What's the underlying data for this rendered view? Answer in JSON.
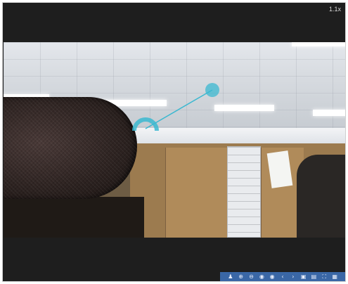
{
  "player": {
    "zoom_label": "1.1x"
  },
  "overlay": {
    "accent_color": "#3bb8d0"
  },
  "toolbar": {
    "buttons": [
      {
        "icon": "person-icon",
        "glyph": "♟"
      },
      {
        "icon": "zoom-in-icon",
        "glyph": "⊕"
      },
      {
        "icon": "zoom-out-icon",
        "glyph": "⊖"
      },
      {
        "icon": "record-icon",
        "glyph": "◉"
      },
      {
        "icon": "stop-icon",
        "glyph": "◉"
      },
      {
        "icon": "prev-icon",
        "glyph": "‹"
      },
      {
        "icon": "next-icon",
        "glyph": "›"
      },
      {
        "icon": "image-icon",
        "glyph": "▣"
      },
      {
        "icon": "film-icon",
        "glyph": "▤"
      },
      {
        "icon": "fullscreen-icon",
        "glyph": "⛶"
      },
      {
        "icon": "grid-icon",
        "glyph": "▦"
      }
    ]
  }
}
